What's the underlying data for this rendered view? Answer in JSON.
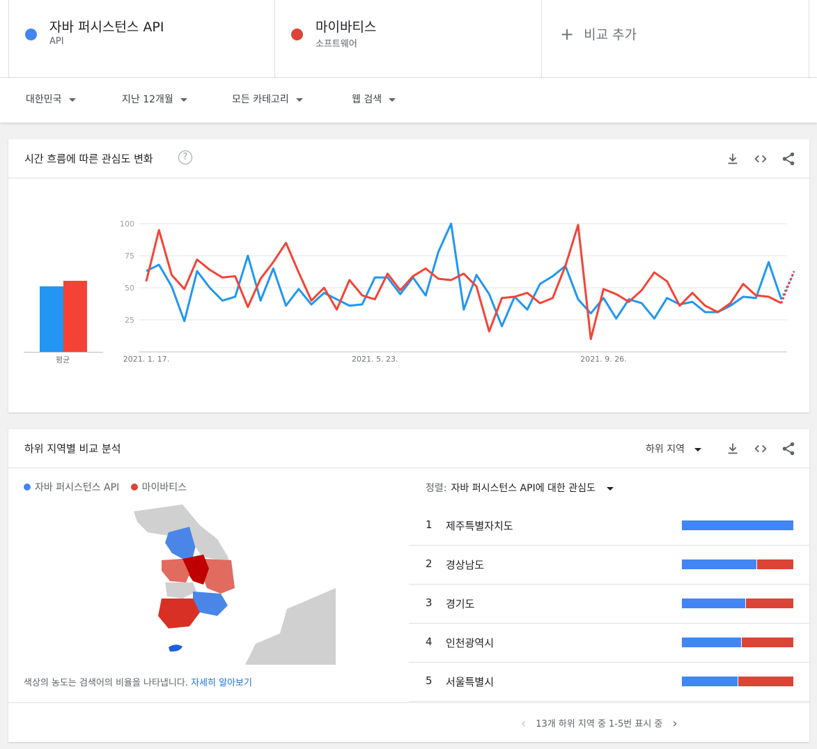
{
  "terms": [
    {
      "name": "자바 퍼시스턴스 API",
      "sub": "API",
      "color": "#4285f4"
    },
    {
      "name": "마이바티스",
      "sub": "소프트웨어",
      "color": "#db4437"
    }
  ],
  "add_compare_label": "비교 추가",
  "filters": {
    "region": "대한민국",
    "period": "지난 12개월",
    "category": "모든 카테고리",
    "search_type": "웹 검색"
  },
  "interest_over_time": {
    "title": "시간 흐름에 따른 관심도 변화",
    "help": "?",
    "avg_label": "평균",
    "averages": [
      47,
      51
    ]
  },
  "chart_data": {
    "type": "line",
    "title": "",
    "xlabel": "",
    "ylabel": "",
    "ylim": [
      0,
      100
    ],
    "yticks": [
      "100",
      "75",
      "50",
      "25"
    ],
    "x_tick_labels": [
      "2021. 1. 17.",
      "2021. 5. 23.",
      "2021. 9. 26."
    ],
    "x_tick_indices": [
      0,
      18,
      36
    ],
    "grid": true,
    "series": [
      {
        "name": "자바 퍼시스턴스 API",
        "color": "#4285f4",
        "values": [
          63,
          68,
          51,
          24,
          63,
          50,
          40,
          43,
          75,
          40,
          65,
          36,
          49,
          37,
          46,
          41,
          36,
          37,
          58,
          58,
          45,
          58,
          44,
          78,
          100,
          33,
          60,
          45,
          20,
          43,
          33,
          53,
          59,
          67,
          41,
          30,
          42,
          26,
          41,
          38,
          26,
          42,
          37,
          39,
          31,
          31,
          36,
          43,
          42,
          70,
          41,
          62
        ]
      },
      {
        "name": "마이바티스",
        "color": "#db4437",
        "values": [
          55,
          95,
          60,
          49,
          72,
          64,
          58,
          59,
          35,
          57,
          70,
          85,
          62,
          40,
          50,
          33,
          56,
          44,
          41,
          61,
          48,
          59,
          65,
          57,
          56,
          61,
          51,
          16,
          42,
          43,
          46,
          38,
          42,
          67,
          99,
          10,
          49,
          45,
          39,
          48,
          62,
          55,
          36,
          46,
          36,
          31,
          38,
          53,
          44,
          43,
          38,
          63
        ]
      }
    ]
  },
  "subregion": {
    "title": "하위 지역별 비교 분석",
    "selector": "하위 지역",
    "legend": [
      "자바 퍼시스턴스 API",
      "마이바티스"
    ],
    "note": "색상의 농도는 검색어의 비율을 나타냅니다.",
    "note_link": "자세히 알아보기",
    "sort_label": "정렬:",
    "sort_value": "자바 퍼시스턴스 API에 대한 관심도",
    "rows": [
      {
        "rank": "1",
        "name": "제주특별자치도",
        "blue": 100,
        "red": 0
      },
      {
        "rank": "2",
        "name": "경상남도",
        "blue": 67,
        "red": 33
      },
      {
        "rank": "3",
        "name": "경기도",
        "blue": 57,
        "red": 43
      },
      {
        "rank": "4",
        "name": "인천광역시",
        "blue": 53,
        "red": 47
      },
      {
        "rank": "5",
        "name": "서울특별시",
        "blue": 50,
        "red": 50
      }
    ],
    "pager": "13개 하위 지역 중 1-5번 표시 중"
  }
}
